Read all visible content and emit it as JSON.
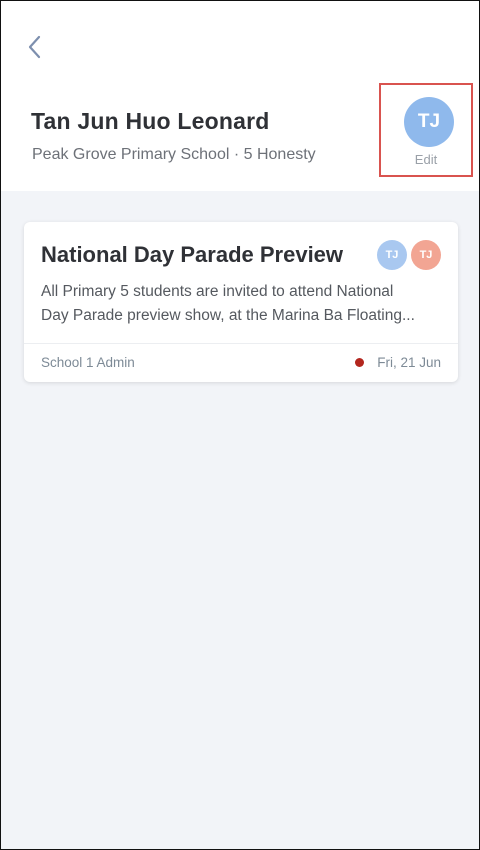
{
  "header": {
    "student_name": "Tan Jun Huo Leonard",
    "school_line": "Peak Grove Primary School · 5 Honesty",
    "avatar_initials": "TJ",
    "edit_label": "Edit"
  },
  "announcement": {
    "title": "National Day Parade Preview",
    "body_line1": "All Primary 5 students are invited to attend National",
    "body_line2": "Day Parade preview show, at the Marina Ba Floating...",
    "sender": "School 1 Admin",
    "date": "Fri, 21 Jun",
    "chips": [
      {
        "initials": "TJ",
        "color": "#a9c8f0"
      },
      {
        "initials": "TJ",
        "color": "#f2a593"
      }
    ],
    "unread_color": "#b3261e"
  },
  "colors": {
    "avatar": "#8fb9ec",
    "highlight_border": "#d9534f",
    "background": "#f2f4f8"
  }
}
